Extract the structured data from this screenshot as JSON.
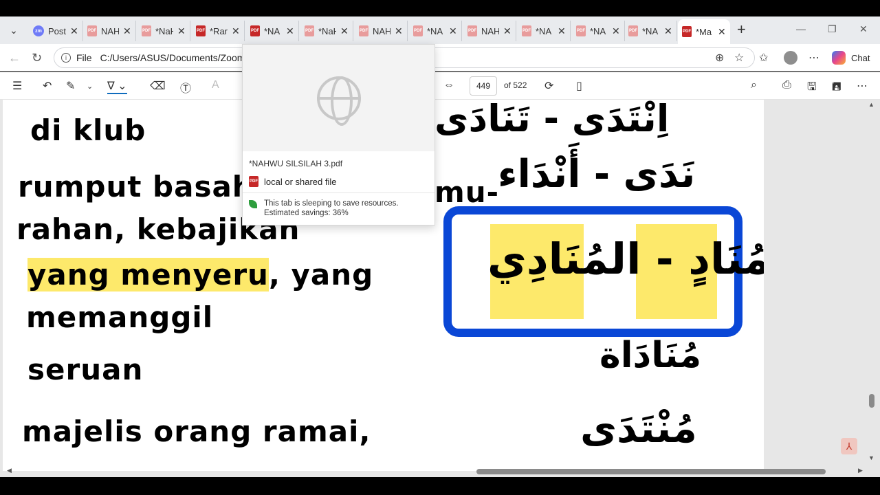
{
  "tabs": [
    {
      "label": "Post",
      "icon": "zoom-icon"
    },
    {
      "label": "NAH",
      "icon": "pdf-icon"
    },
    {
      "label": "*NaH",
      "icon": "pdf-icon"
    },
    {
      "label": "*Rar",
      "icon": "pdf-icon"
    },
    {
      "label": "*NA",
      "icon": "pdf-icon"
    },
    {
      "label": "*NaH",
      "icon": "pdf-icon"
    },
    {
      "label": "NAH",
      "icon": "pdf-icon"
    },
    {
      "label": "*NA",
      "icon": "pdf-icon"
    },
    {
      "label": "NAH",
      "icon": "pdf-icon"
    },
    {
      "label": "*NA",
      "icon": "pdf-icon"
    },
    {
      "label": "*NA",
      "icon": "pdf-icon"
    },
    {
      "label": "*NA",
      "icon": "pdf-icon"
    },
    {
      "label": "*Ma",
      "icon": "pdf-icon"
    }
  ],
  "address": {
    "scheme_label": "File",
    "url": "C:/Users/ASUS/Documents/Zoom/N"
  },
  "chat_label": "Chat",
  "pdf_toolbar": {
    "page_current": "449",
    "page_total": "of 522"
  },
  "hover_card": {
    "title": "*NAHWU SILSILAH 3.pdf",
    "source": "local or shared file",
    "sleep_line1": "This tab is sleeping to save resources.",
    "sleep_line2": "Estimated savings: 36%"
  },
  "page": {
    "left_lines": [
      "di klub",
      "rumput basah",
      "rahan, kebajikan",
      "yang menyeru",
      ", yang",
      "memanggil",
      "seruan",
      "majelis orang ramai,"
    ],
    "arabic": {
      "top": "اِنْتَدَى - تَنَادَى",
      "second": "نَدَى - أَنْدَاء",
      "second_fragment": "mu-",
      "boxed": "مُنَادٍ - المُنَادِي",
      "third": "مُنَادَاة",
      "fourth": "مُنْتَدَى"
    }
  },
  "colors": {
    "highlight": "#fde96b",
    "box_border": "#0a47d6",
    "accent": "#0f6cbd"
  }
}
